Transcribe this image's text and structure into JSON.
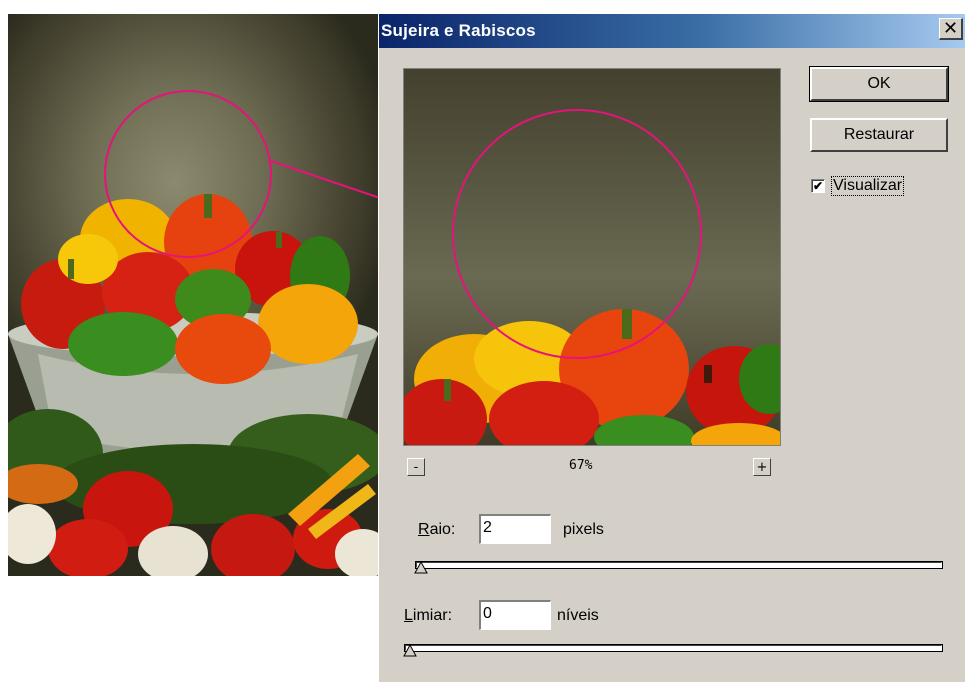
{
  "window": {
    "title": "Sujeira e Rabiscos"
  },
  "buttons": {
    "ok": "OK",
    "restore": "Restaurar",
    "close": "✕"
  },
  "preview_toggle": {
    "label": "Visualizar",
    "checked": true
  },
  "zoom": {
    "minus": "-",
    "plus": "+",
    "level": "67%"
  },
  "radius": {
    "label_accel": "R",
    "label_rest": "aio:",
    "value": "2",
    "unit": "pixels",
    "slider_fraction": 0.0
  },
  "threshold": {
    "label_accel": "L",
    "label_rest": "imiar:",
    "value": "0",
    "unit": "níveis",
    "slider_fraction": 0.0
  },
  "colors": {
    "title_start": "#0a246a",
    "title_end": "#a6caf0",
    "annotation": "#e5137a",
    "dialog_bg": "#d4d0c8"
  }
}
